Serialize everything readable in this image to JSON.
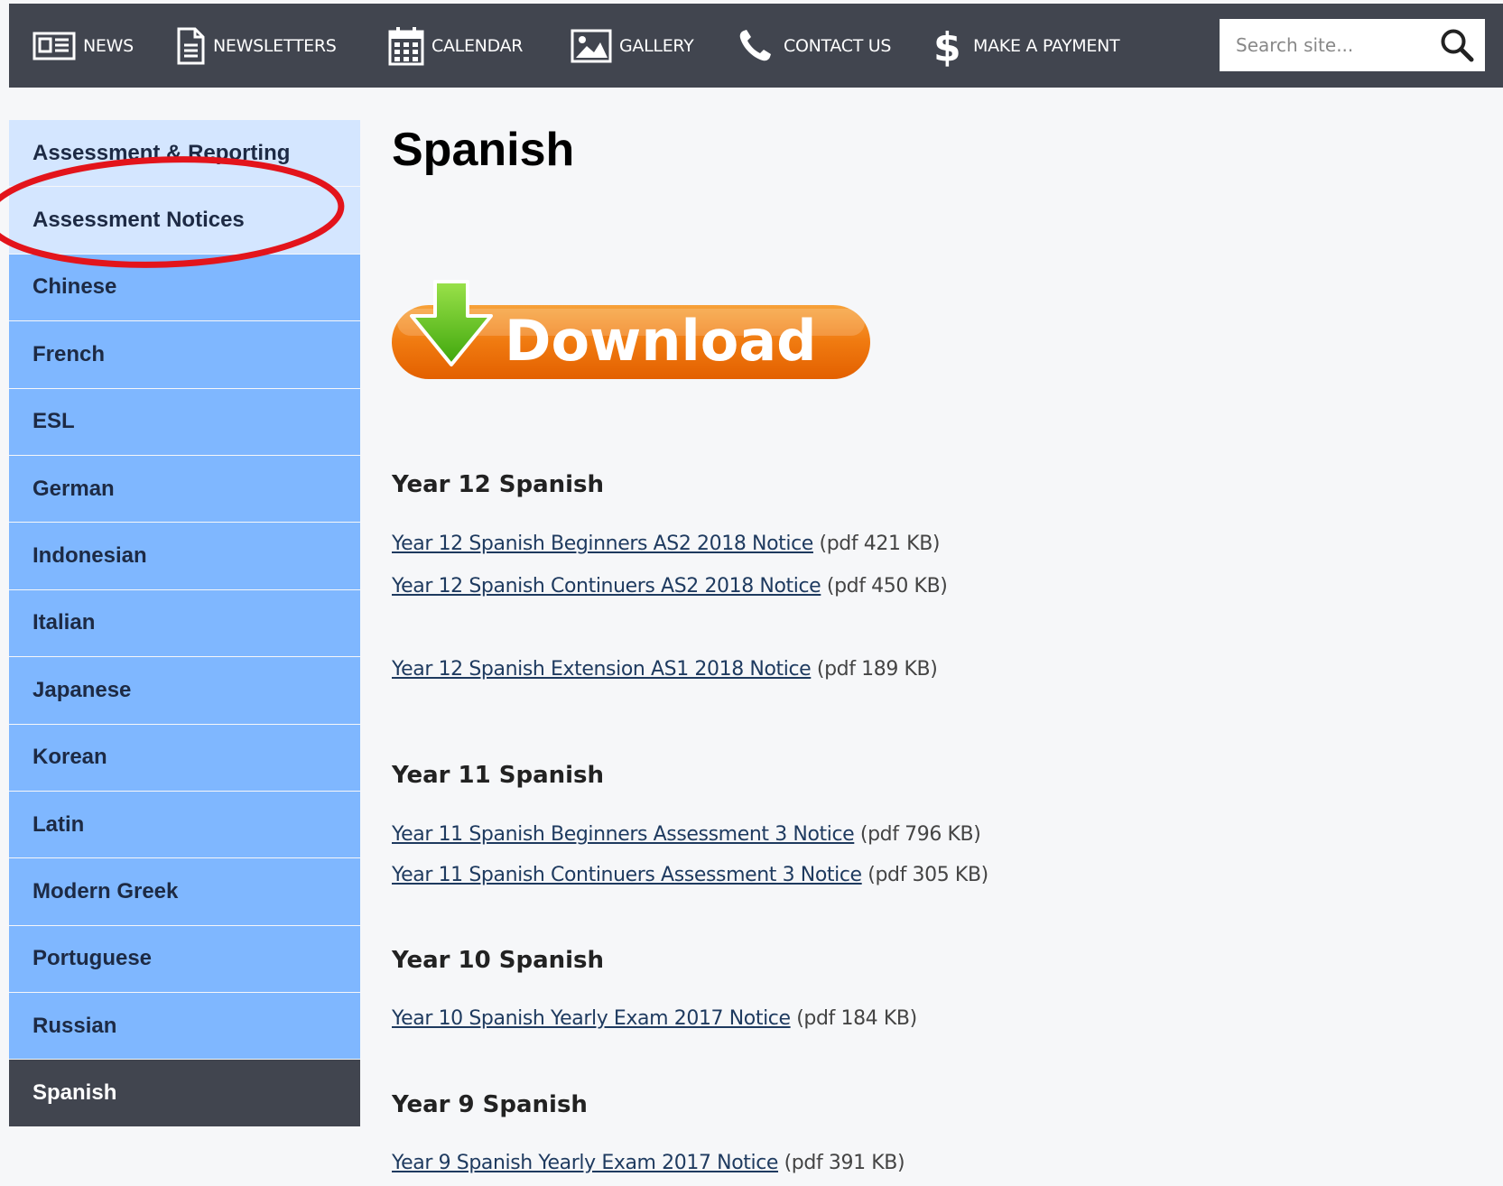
{
  "nav": {
    "items": [
      {
        "label": "NEWS",
        "icon": "newspaper-icon"
      },
      {
        "label": "NEWSLETTERS",
        "icon": "document-icon"
      },
      {
        "label": "CALENDAR",
        "icon": "calendar-icon"
      },
      {
        "label": "GALLERY",
        "icon": "image-icon"
      },
      {
        "label": "CONTACT US",
        "icon": "phone-icon"
      },
      {
        "label": "MAKE A PAYMENT",
        "icon": "dollar-icon"
      }
    ],
    "search": {
      "placeholder": "Search site..."
    }
  },
  "sidebar": {
    "items": [
      {
        "label": "Assessment & Reporting"
      },
      {
        "label": "Assessment Notices"
      },
      {
        "label": "Chinese"
      },
      {
        "label": "French"
      },
      {
        "label": "ESL"
      },
      {
        "label": "German"
      },
      {
        "label": "Indonesian"
      },
      {
        "label": "Italian"
      },
      {
        "label": "Japanese"
      },
      {
        "label": "Korean"
      },
      {
        "label": "Latin"
      },
      {
        "label": "Modern Greek"
      },
      {
        "label": "Portuguese"
      },
      {
        "label": "Russian"
      },
      {
        "label": "Spanish"
      }
    ],
    "active_item": "Spanish"
  },
  "main": {
    "title": "Spanish",
    "download_text": "Download",
    "sections": [
      {
        "heading": "Year 12 Spanish",
        "docs": [
          {
            "link": "Year 12 Spanish Beginners AS2 2018 Notice",
            "meta": "(pdf 421 KB)"
          },
          {
            "link": "Year 12 Spanish Continuers AS2 2018 Notice",
            "meta": "(pdf 450 KB)"
          },
          {
            "link": "Year 12 Spanish Extension AS1 2018 Notice",
            "meta": "(pdf 189 KB)"
          }
        ]
      },
      {
        "heading": "Year 11 Spanish",
        "docs": [
          {
            "link": "Year 11 Spanish Beginners Assessment 3 Notice",
            "meta": "(pdf 796 KB)"
          },
          {
            "link": "Year 11 Spanish Continuers Assessment 3 Notice",
            "meta": "(pdf 305 KB)"
          }
        ]
      },
      {
        "heading": "Year 10 Spanish",
        "docs": [
          {
            "link": "Year 10 Spanish Yearly Exam 2017 Notice",
            "meta": "(pdf 184 KB)"
          }
        ]
      },
      {
        "heading": "Year 9 Spanish",
        "docs": [
          {
            "link": "Year 9 Spanish Yearly Exam 2017 Notice",
            "meta": "(pdf 391 KB)"
          }
        ]
      }
    ]
  },
  "colors": {
    "nav_bg": "#41454f",
    "sidebar_item": "#7fb7ff",
    "sidebar_item_light": "#d4e6ff",
    "sidebar_active": "#41454f",
    "annotation": "#e3141b",
    "download_orange": "#f07a10",
    "download_arrow_green": "#5cc418"
  }
}
